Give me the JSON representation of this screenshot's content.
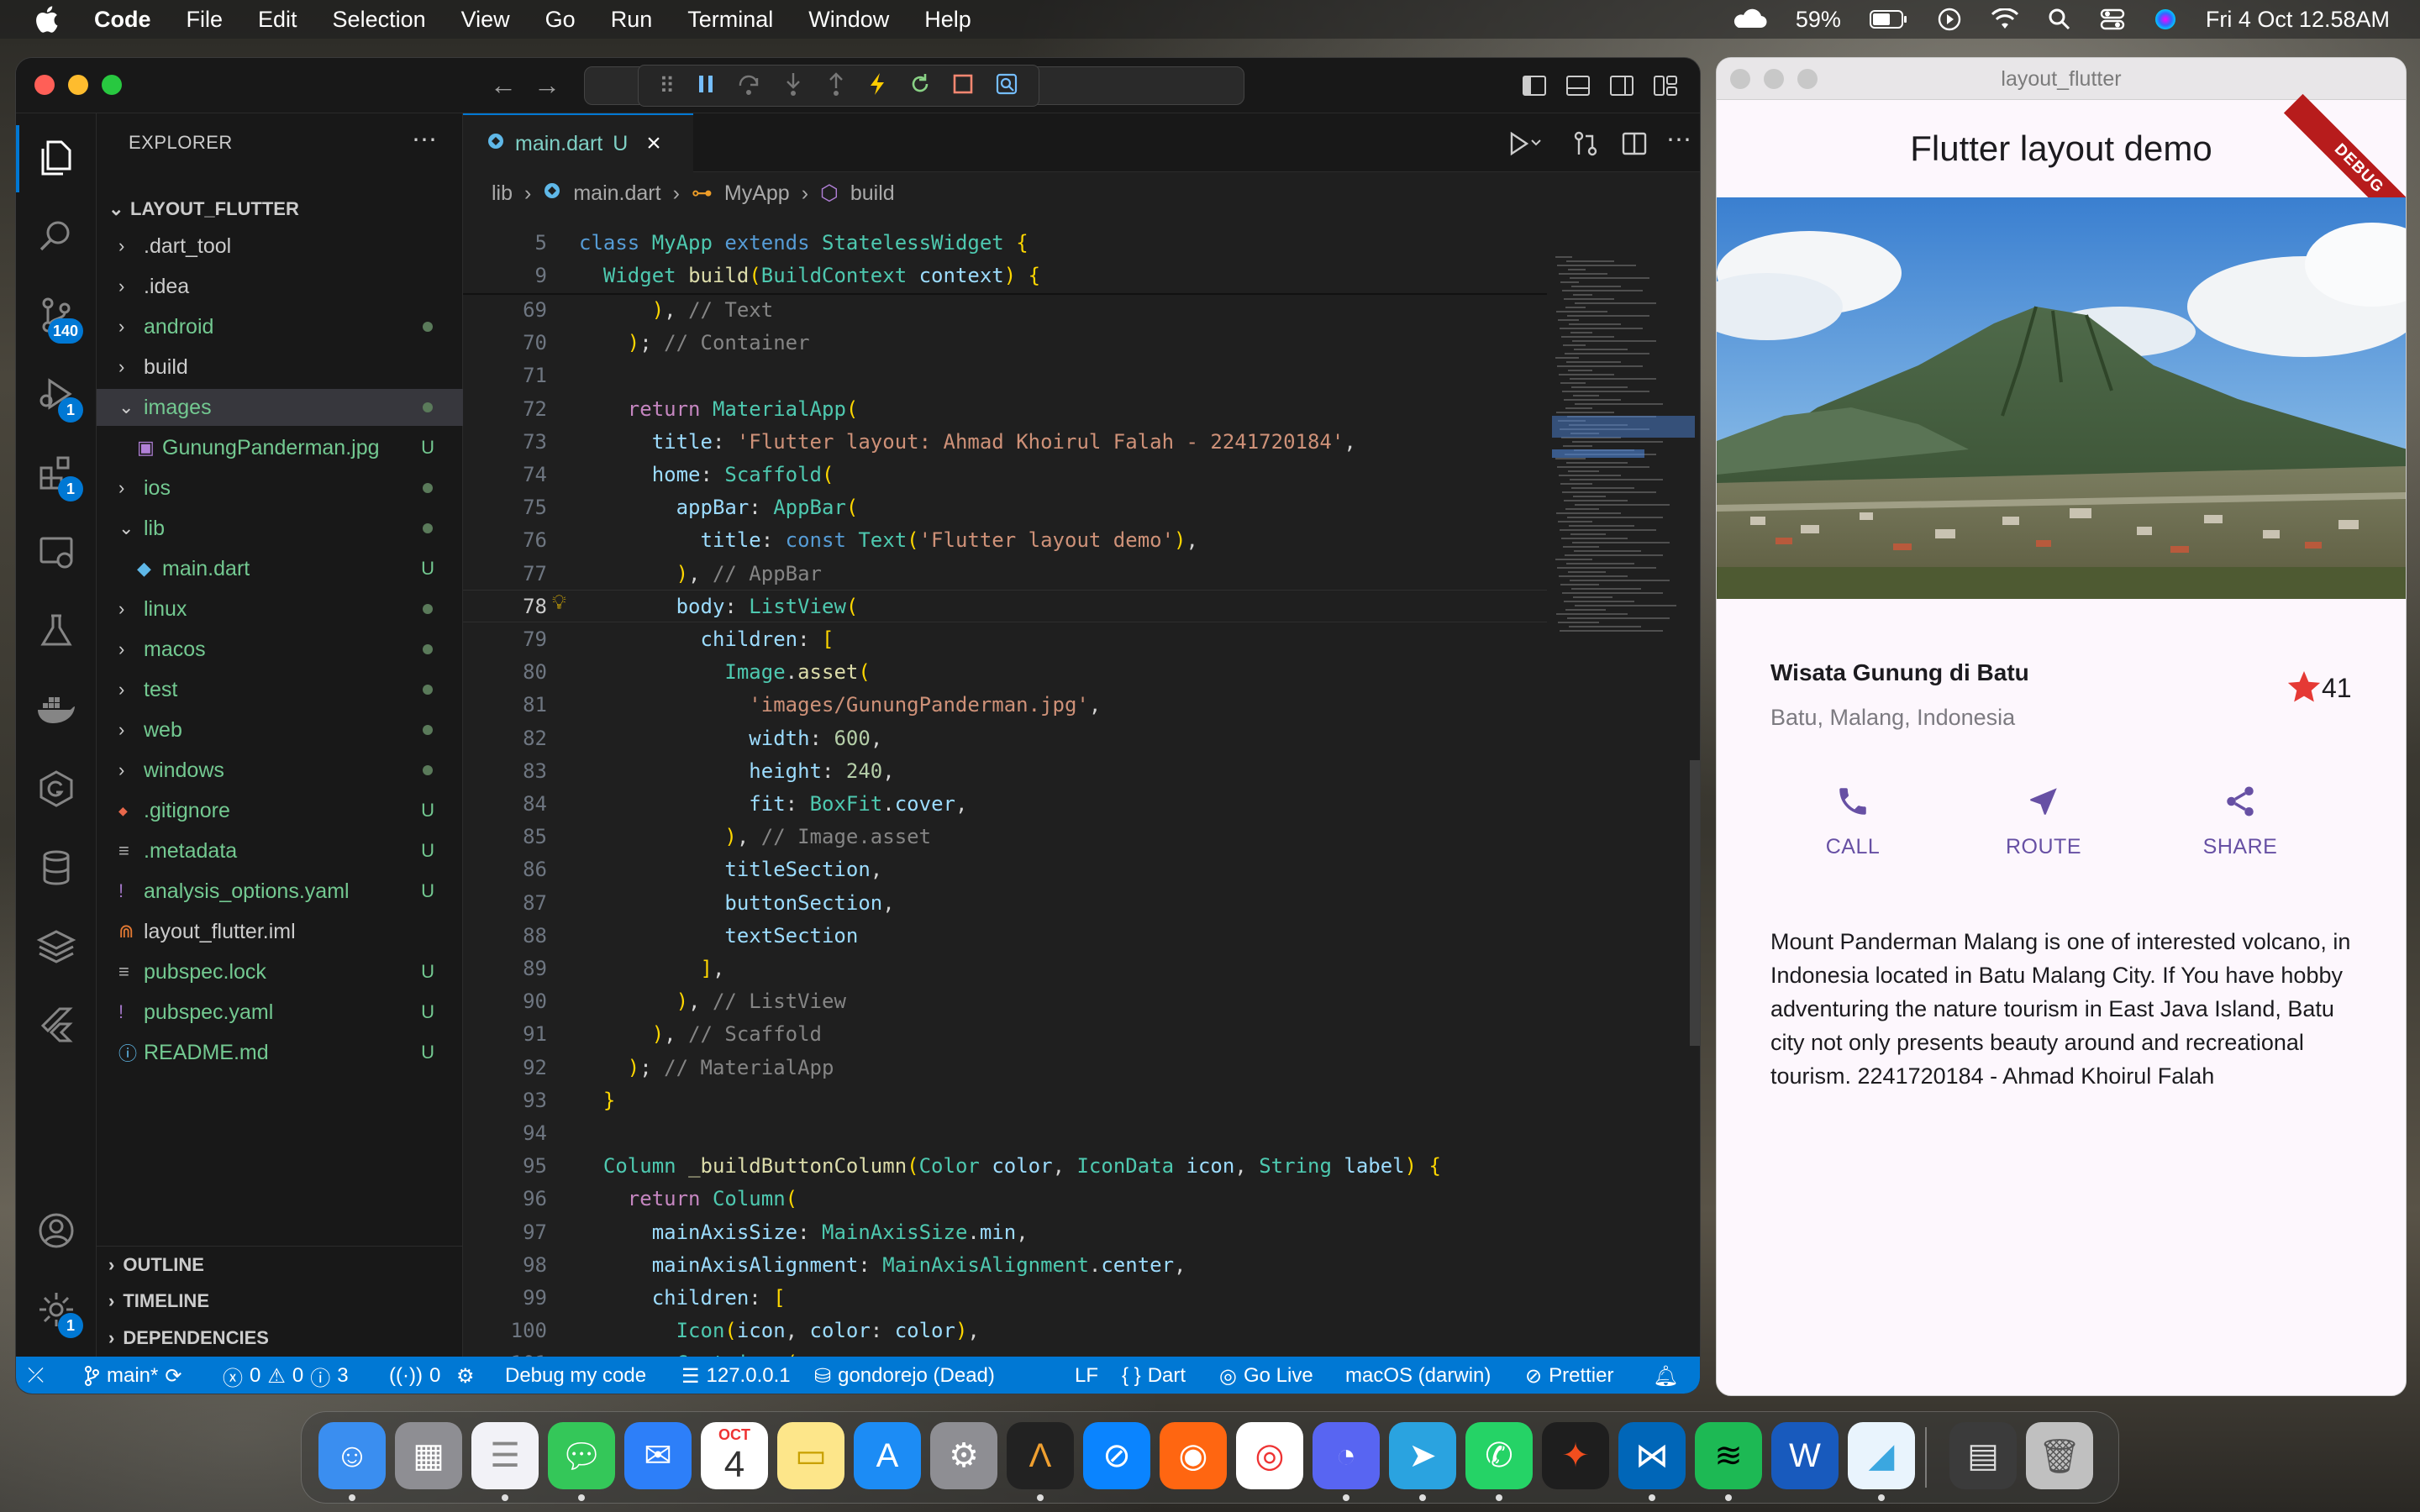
{
  "menubar": {
    "app": "Code",
    "items": [
      "File",
      "Edit",
      "Selection",
      "View",
      "Go",
      "Run",
      "Terminal",
      "Window",
      "Help"
    ],
    "battery": "59%",
    "datetime": "Fri 4 Oct  12.58AM"
  },
  "vscode": {
    "explorer_title": "EXPLORER",
    "root": "LAYOUT_FLUTTER",
    "tree": [
      {
        "name": ".dart_tool",
        "status": ""
      },
      {
        "name": ".idea",
        "status": ""
      },
      {
        "name": "android",
        "status": "•"
      },
      {
        "name": "build",
        "status": ""
      },
      {
        "name": "images",
        "status": "•"
      },
      {
        "name": "GunungPanderman.jpg",
        "status": "U"
      },
      {
        "name": "ios",
        "status": "•"
      },
      {
        "name": "lib",
        "status": "•"
      },
      {
        "name": "main.dart",
        "status": "U"
      },
      {
        "name": "linux",
        "status": "•"
      },
      {
        "name": "macos",
        "status": "•"
      },
      {
        "name": "test",
        "status": "•"
      },
      {
        "name": "web",
        "status": "•"
      },
      {
        "name": "windows",
        "status": "•"
      },
      {
        "name": ".gitignore",
        "status": "U"
      },
      {
        "name": ".metadata",
        "status": "U"
      },
      {
        "name": "analysis_options.yaml",
        "status": "U"
      },
      {
        "name": "layout_flutter.iml",
        "status": ""
      },
      {
        "name": "pubspec.lock",
        "status": "U"
      },
      {
        "name": "pubspec.yaml",
        "status": "U"
      },
      {
        "name": "README.md",
        "status": "U"
      }
    ],
    "sections": [
      "OUTLINE",
      "TIMELINE",
      "DEPENDENCIES"
    ],
    "badges": {
      "scm": "140",
      "debug": "1",
      "extensions": "1",
      "settings": "1"
    },
    "tab": {
      "name": "main.dart",
      "status": "U"
    },
    "breadcrumbs": [
      "lib",
      "main.dart",
      "MyApp",
      "build"
    ],
    "sticky": [
      {
        "ln": "5",
        "code": "class MyApp extends StatelessWidget {"
      },
      {
        "ln": "9",
        "code": "  Widget build(BuildContext context) {"
      }
    ],
    "code_lines": [
      {
        "ln": "69",
        "code": "      ), // Text"
      },
      {
        "ln": "70",
        "code": "    ); // Container"
      },
      {
        "ln": "71",
        "code": ""
      },
      {
        "ln": "72",
        "code": "    return MaterialApp("
      },
      {
        "ln": "73",
        "code": "      title: 'Flutter layout: Ahmad Khoirul Falah - 2241720184',"
      },
      {
        "ln": "74",
        "code": "      home: Scaffold("
      },
      {
        "ln": "75",
        "code": "        appBar: AppBar("
      },
      {
        "ln": "76",
        "code": "          title: const Text('Flutter layout demo'),"
      },
      {
        "ln": "77",
        "code": "        ), // AppBar"
      },
      {
        "ln": "78",
        "code": "        body: ListView("
      },
      {
        "ln": "79",
        "code": "          children: ["
      },
      {
        "ln": "80",
        "code": "            Image.asset("
      },
      {
        "ln": "81",
        "code": "              'images/GunungPanderman.jpg',"
      },
      {
        "ln": "82",
        "code": "              width: 600,"
      },
      {
        "ln": "83",
        "code": "              height: 240,"
      },
      {
        "ln": "84",
        "code": "              fit: BoxFit.cover,"
      },
      {
        "ln": "85",
        "code": "            ), // Image.asset"
      },
      {
        "ln": "86",
        "code": "            titleSection,"
      },
      {
        "ln": "87",
        "code": "            buttonSection,"
      },
      {
        "ln": "88",
        "code": "            textSection"
      },
      {
        "ln": "89",
        "code": "          ],"
      },
      {
        "ln": "90",
        "code": "        ), // ListView"
      },
      {
        "ln": "91",
        "code": "      ), // Scaffold"
      },
      {
        "ln": "92",
        "code": "    ); // MaterialApp"
      },
      {
        "ln": "93",
        "code": "  }"
      },
      {
        "ln": "94",
        "code": ""
      },
      {
        "ln": "95",
        "code": "  Column _buildButtonColumn(Color color, IconData icon, String label) {"
      },
      {
        "ln": "96",
        "code": "    return Column("
      },
      {
        "ln": "97",
        "code": "      mainAxisSize: MainAxisSize.min,"
      },
      {
        "ln": "98",
        "code": "      mainAxisAlignment: MainAxisAlignment.center,"
      },
      {
        "ln": "99",
        "code": "      children: ["
      },
      {
        "ln": "100",
        "code": "        Icon(icon, color: color),"
      },
      {
        "ln": "101",
        "code": "        Container("
      },
      {
        "ln": "102",
        "code": "          margin: const EdgeInsets.only(top: 8),"
      },
      {
        "ln": "103",
        "code": "          child: Text("
      }
    ],
    "status": {
      "branch": "main*",
      "errors": "0",
      "warnings": "0",
      "info": "3",
      "ports": "0",
      "debug": "Debug my code",
      "host": "127.0.0.1",
      "db": "gondorejo (Dead)",
      "eol": "LF",
      "lang": "Dart",
      "golive": "Go Live",
      "device": "macOS (darwin)",
      "prettier": "Prettier"
    }
  },
  "flutter": {
    "window_title": "layout_flutter",
    "appbar_title": "Flutter layout demo",
    "debug_banner": "DEBUG",
    "title": "Wisata Gunung di Batu",
    "subtitle": "Batu, Malang, Indonesia",
    "rating": "41",
    "buttons": [
      "CALL",
      "ROUTE",
      "SHARE"
    ],
    "description": "Mount Panderman Malang is one of interested volcano, in Indonesia located in Batu Malang City. If You have hobby adventuring the nature tourism in East Java Island, Batu city not only presents beauty around and recreational tourism. 2241720184 - Ahmad Khoirul Falah",
    "accent": "#6750a4",
    "star_color": "#e53935"
  },
  "dock": {
    "apps": [
      "Finder",
      "Launchpad",
      "Reminders",
      "Messages",
      "Mail",
      "Calendar",
      "Notes",
      "App Store",
      "System Settings",
      "Instruments",
      "Safari",
      "Firefox",
      "Chrome",
      "Discord",
      "Telegram",
      "WhatsApp",
      "Figma",
      "Visual Studio Code",
      "Spotify",
      "Word",
      "Flutter",
      "Preview",
      "Trash"
    ],
    "calendar_month": "OCT",
    "calendar_day": "4"
  }
}
